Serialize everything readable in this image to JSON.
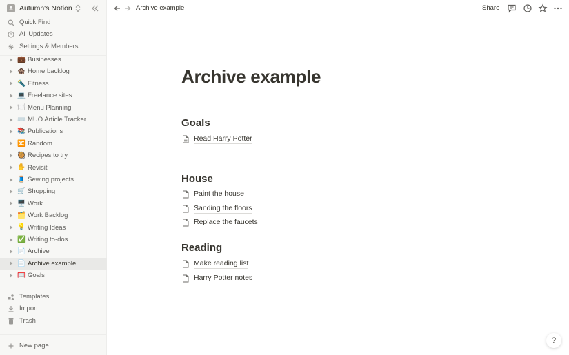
{
  "workspace": {
    "avatar_letter": "A",
    "name": "Autumn's Notion"
  },
  "nav": {
    "quick_find": "Quick Find",
    "all_updates": "All Updates",
    "settings": "Settings & Members"
  },
  "tree": [
    {
      "emoji": "💼",
      "label": "Businesses"
    },
    {
      "emoji": "🏚️",
      "label": "Home backlog"
    },
    {
      "emoji": "🔦",
      "label": "Fitness"
    },
    {
      "emoji": "💻",
      "label": "Freelance sites"
    },
    {
      "emoji": "🍽️",
      "label": "Menu Planning"
    },
    {
      "emoji": "⌨️",
      "label": "MUO Article Tracker"
    },
    {
      "emoji": "📚",
      "label": "Publications"
    },
    {
      "emoji": "🔀",
      "label": "Random"
    },
    {
      "emoji": "🥘",
      "label": "Recipes to try"
    },
    {
      "emoji": "✋",
      "label": "Revisit"
    },
    {
      "emoji": "🧵",
      "label": "Sewing projects"
    },
    {
      "emoji": "🛒",
      "label": "Shopping"
    },
    {
      "emoji": "🖥️",
      "label": "Work"
    },
    {
      "emoji": "🗂️",
      "label": "Work Backlog"
    },
    {
      "emoji": "💡",
      "label": "Writing Ideas"
    },
    {
      "emoji": "✅",
      "label": "Writing to-dos"
    },
    {
      "emoji": "📄",
      "label": "Archive"
    },
    {
      "emoji": "📄",
      "label": "Archive example",
      "active": true
    },
    {
      "emoji": "🥅",
      "label": "Goals"
    }
  ],
  "bottom_nav": {
    "templates": "Templates",
    "import": "Import",
    "trash": "Trash",
    "new_page": "New page"
  },
  "topbar": {
    "breadcrumb": "Archive example",
    "share": "Share"
  },
  "page": {
    "title": "Archive example",
    "sections": [
      {
        "heading": "Goals",
        "links": [
          "Read Harry Potter"
        ]
      },
      {
        "heading": "House",
        "links": [
          "Paint the house",
          "Sanding the floors",
          "Replace the faucets"
        ]
      },
      {
        "heading": "Reading",
        "links": [
          "Make reading list",
          "Harry Potter notes"
        ]
      }
    ]
  },
  "help": "?",
  "colors": {
    "sidebar_bg": "#f7f7f5",
    "active_bg": "#e9e9e7",
    "text": "#37352f",
    "muted": "#5f5e5b"
  }
}
